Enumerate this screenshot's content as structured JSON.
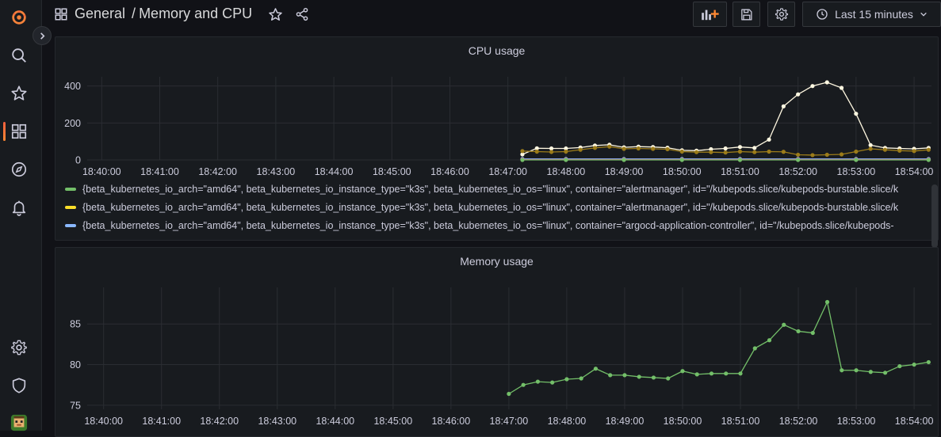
{
  "sidebar": {
    "items": [
      {
        "name": "grafana-logo",
        "icon": "grafana-logo"
      },
      {
        "name": "search",
        "icon": "search-icon"
      },
      {
        "name": "starred",
        "icon": "star-icon"
      },
      {
        "name": "dashboards",
        "icon": "dashboards-icon",
        "active": true
      },
      {
        "name": "explore",
        "icon": "compass-icon"
      },
      {
        "name": "alerting",
        "icon": "bell-icon"
      },
      {
        "name": "configuration",
        "icon": "gear-icon"
      },
      {
        "name": "server-admin",
        "icon": "shield-icon"
      },
      {
        "name": "profile",
        "icon": "avatar"
      }
    ]
  },
  "header": {
    "folder": "General",
    "separator": "/",
    "title": "Memory and CPU",
    "time_range": "Last 15 minutes"
  },
  "colors": {
    "accent": "#f55f3e",
    "green": "#73bf69",
    "yellow": "#fade2a",
    "blue": "#8ab8ff",
    "white_series": "#fff8e1"
  },
  "panels": {
    "cpu": {
      "title": "CPU usage",
      "legend": [
        {
          "color": "#73bf69",
          "label": "{beta_kubernetes_io_arch=\"amd64\", beta_kubernetes_io_instance_type=\"k3s\", beta_kubernetes_io_os=\"linux\", container=\"alertmanager\", id=\"/kubepods.slice/kubepods-burstable.slice/k"
        },
        {
          "color": "#fade2a",
          "label": "{beta_kubernetes_io_arch=\"amd64\", beta_kubernetes_io_instance_type=\"k3s\", beta_kubernetes_io_os=\"linux\", container=\"alertmanager\", id=\"/kubepods.slice/kubepods-burstable.slice/k"
        },
        {
          "color": "#8ab8ff",
          "label": "{beta_kubernetes_io_arch=\"amd64\", beta_kubernetes_io_instance_type=\"k3s\", beta_kubernetes_io_os=\"linux\", container=\"argocd-application-controller\", id=\"/kubepods.slice/kubepods-"
        }
      ]
    },
    "memory": {
      "title": "Memory usage"
    }
  },
  "chart_data": [
    {
      "type": "line",
      "title": "CPU usage",
      "x_ticks": [
        "18:40:00",
        "18:41:00",
        "18:42:00",
        "18:43:00",
        "18:44:00",
        "18:45:00",
        "18:46:00",
        "18:47:00",
        "18:48:00",
        "18:49:00",
        "18:50:00",
        "18:51:00",
        "18:52:00",
        "18:53:00",
        "18:54:00"
      ],
      "y_ticks": [
        0,
        200,
        400
      ],
      "ylim": [
        0,
        450
      ],
      "xlim_minutes": [
        18.75,
        34.3
      ],
      "x_start": "18:39:45",
      "x_end": "18:54:18",
      "series": [
        {
          "color": "#fff8e1",
          "x": [
            "18:47:15",
            "18:47:30",
            "18:47:45",
            "18:48:00",
            "18:48:15",
            "18:48:30",
            "18:48:45",
            "18:49:00",
            "18:49:15",
            "18:49:30",
            "18:49:45",
            "18:50:00",
            "18:50:15",
            "18:50:30",
            "18:50:45",
            "18:51:00",
            "18:51:15",
            "18:51:30",
            "18:51:45",
            "18:52:00",
            "18:52:15",
            "18:52:30",
            "18:52:45",
            "18:53:00",
            "18:53:15",
            "18:53:30",
            "18:53:45",
            "18:54:00",
            "18:54:15"
          ],
          "values": [
            30,
            63,
            62,
            62,
            67,
            78,
            82,
            68,
            72,
            70,
            66,
            52,
            50,
            58,
            62,
            70,
            65,
            110,
            290,
            355,
            400,
            420,
            390,
            250,
            80,
            65,
            62,
            60,
            65
          ]
        },
        {
          "color": "#9c7c1a",
          "x": [
            "18:47:15",
            "18:47:30",
            "18:47:45",
            "18:48:00",
            "18:48:15",
            "18:48:30",
            "18:48:45",
            "18:49:00",
            "18:49:15",
            "18:49:30",
            "18:49:45",
            "18:50:00",
            "18:50:15",
            "18:50:30",
            "18:50:45",
            "18:51:00",
            "18:51:15",
            "18:51:30",
            "18:51:45",
            "18:52:00",
            "18:52:15",
            "18:52:30",
            "18:52:45",
            "18:53:00",
            "18:53:15",
            "18:53:30",
            "18:53:45",
            "18:54:00",
            "18:54:15"
          ],
          "values": [
            48,
            45,
            43,
            45,
            55,
            65,
            72,
            60,
            62,
            60,
            58,
            45,
            42,
            42,
            40,
            45,
            42,
            45,
            44,
            28,
            26,
            28,
            30,
            45,
            60,
            55,
            50,
            48,
            55
          ]
        },
        {
          "color": "#8ab8ff",
          "x": [
            "18:47:15",
            "18:48:00",
            "18:49:00",
            "18:50:00",
            "18:51:00",
            "18:52:00",
            "18:53:00",
            "18:54:15"
          ],
          "values": [
            5,
            5,
            5,
            5,
            5,
            5,
            5,
            5
          ]
        },
        {
          "color": "#b877d9",
          "x": [
            "18:47:15",
            "18:48:00",
            "18:49:00",
            "18:50:00",
            "18:51:00",
            "18:52:00",
            "18:53:00",
            "18:54:15"
          ],
          "values": [
            2,
            2,
            2,
            2,
            2,
            2,
            2,
            2
          ]
        },
        {
          "color": "#f2495c",
          "x": [
            "18:47:15",
            "18:48:00",
            "18:49:00",
            "18:50:00",
            "18:51:00",
            "18:52:00",
            "18:53:00",
            "18:54:15"
          ],
          "values": [
            1,
            1,
            1,
            1,
            1,
            1,
            1,
            1
          ]
        },
        {
          "color": "#73bf69",
          "x": [
            "18:47:15",
            "18:48:00",
            "18:49:00",
            "18:50:00",
            "18:51:00",
            "18:52:00",
            "18:53:00",
            "18:54:15"
          ],
          "values": [
            0,
            0,
            0,
            0,
            0,
            0,
            0,
            0
          ]
        }
      ]
    },
    {
      "type": "line",
      "title": "Memory usage",
      "x_ticks": [
        "18:40:00",
        "18:41:00",
        "18:42:00",
        "18:43:00",
        "18:44:00",
        "18:45:00",
        "18:46:00",
        "18:47:00",
        "18:48:00",
        "18:49:00",
        "18:50:00",
        "18:51:00",
        "18:52:00",
        "18:53:00",
        "18:54:00"
      ],
      "y_ticks": [
        75,
        80,
        85
      ],
      "ylim": [
        74.5,
        89.5
      ],
      "xlim_minutes": [
        18.72,
        34.3
      ],
      "x_start": "18:39:43",
      "x_end": "18:54:18",
      "series": [
        {
          "color": "#73bf69",
          "x": [
            "18:47:00",
            "18:47:15",
            "18:47:30",
            "18:47:45",
            "18:48:00",
            "18:48:15",
            "18:48:30",
            "18:48:45",
            "18:49:00",
            "18:49:15",
            "18:49:30",
            "18:49:45",
            "18:50:00",
            "18:50:15",
            "18:50:30",
            "18:50:45",
            "18:51:00",
            "18:51:15",
            "18:51:30",
            "18:51:45",
            "18:52:00",
            "18:52:15",
            "18:52:30",
            "18:52:45",
            "18:53:00",
            "18:53:15",
            "18:53:30",
            "18:53:45",
            "18:54:00",
            "18:54:15"
          ],
          "values": [
            76.4,
            77.5,
            77.9,
            77.8,
            78.2,
            78.3,
            79.5,
            78.7,
            78.7,
            78.5,
            78.4,
            78.3,
            79.2,
            78.8,
            78.9,
            78.9,
            78.9,
            82.0,
            83.0,
            84.9,
            84.1,
            83.9,
            87.7,
            79.3,
            79.3,
            79.1,
            79.0,
            79.8,
            80.0,
            80.3
          ]
        }
      ]
    }
  ]
}
